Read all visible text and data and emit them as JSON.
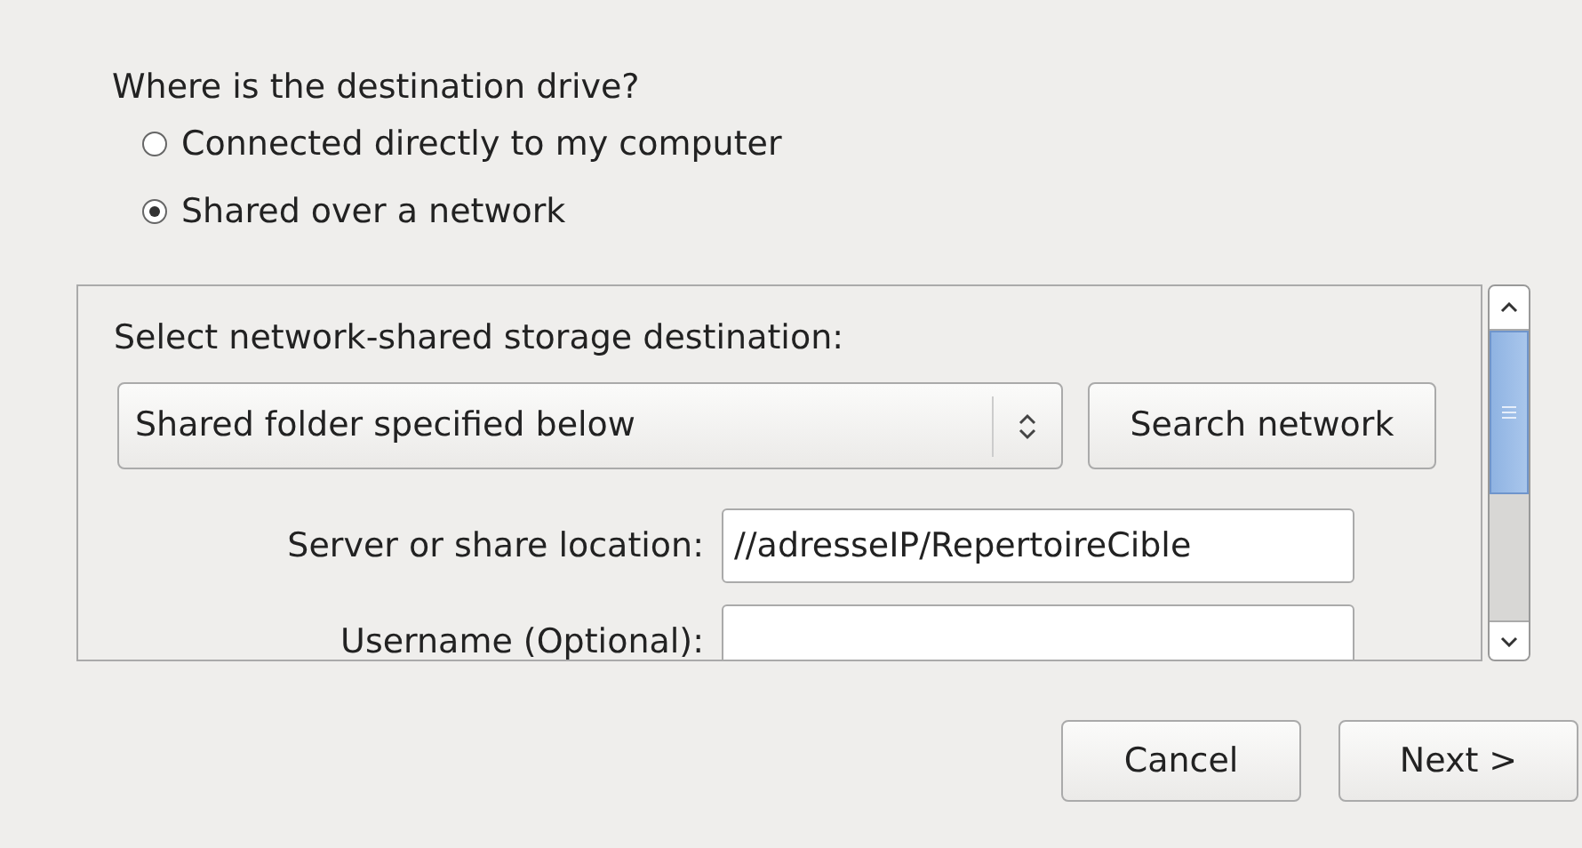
{
  "question": "Where is the destination drive?",
  "options": [
    {
      "label": "Connected directly to my computer",
      "selected": false
    },
    {
      "label": "Shared over a network",
      "selected": true
    }
  ],
  "network_panel": {
    "heading": "Select network-shared storage destination:",
    "dropdown": {
      "value": "Shared folder specified below"
    },
    "search_button": "Search network",
    "fields": [
      {
        "label": "Server or share location:",
        "value": "//adresseIP/RepertoireCible"
      },
      {
        "label": "Username (Optional):"
      }
    ]
  },
  "buttons": [
    "Cancel",
    "Next >"
  ]
}
